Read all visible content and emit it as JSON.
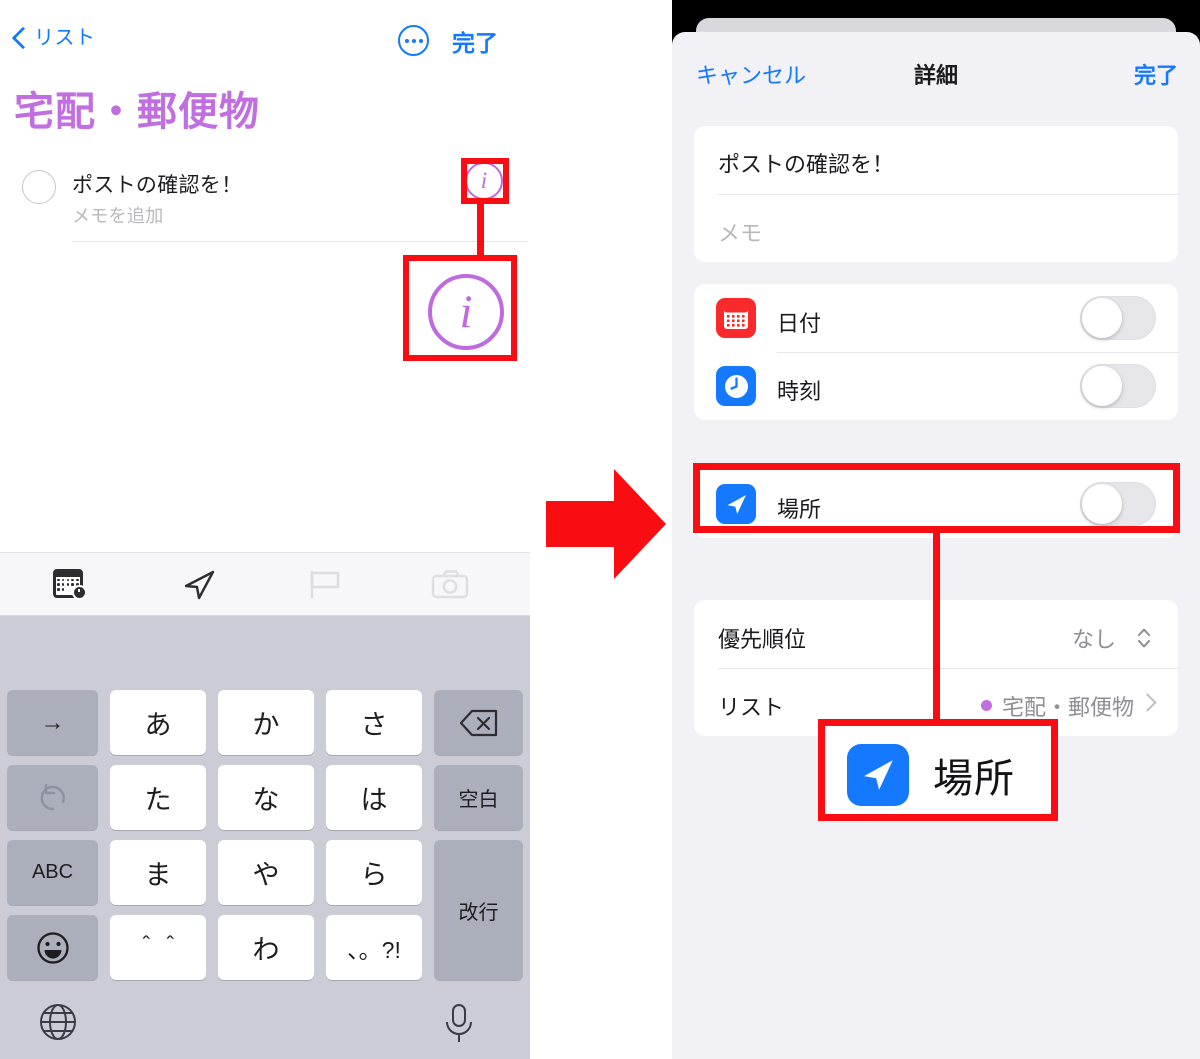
{
  "left": {
    "nav": {
      "back_label": "リスト",
      "more_icon": "ellipsis-circle-icon",
      "done_label": "完了"
    },
    "list_title": "宅配・郵便物",
    "task": {
      "title": "ポストの確認を！",
      "note_placeholder": "メモを追加",
      "info_glyph": "i"
    },
    "callout": {
      "info_glyph": "i"
    },
    "toolbar": [
      {
        "icon": "calendar-clock-icon",
        "active": true
      },
      {
        "icon": "location-arrow-icon",
        "active": true
      },
      {
        "icon": "flag-icon",
        "active": false
      },
      {
        "icon": "camera-icon",
        "active": false
      }
    ],
    "keyboard": {
      "rows": [
        [
          {
            "label": "→",
            "style": "gray",
            "name": "cursor-right-key"
          },
          {
            "label": "あ",
            "style": "white",
            "name": "kana-a-key"
          },
          {
            "label": "か",
            "style": "white",
            "name": "kana-ka-key"
          },
          {
            "label": "さ",
            "style": "white",
            "name": "kana-sa-key"
          },
          {
            "label": "",
            "style": "gray",
            "name": "backspace-key"
          }
        ],
        [
          {
            "label": "↺",
            "style": "gray",
            "name": "undo-key"
          },
          {
            "label": "た",
            "style": "white",
            "name": "kana-ta-key"
          },
          {
            "label": "な",
            "style": "white",
            "name": "kana-na-key"
          },
          {
            "label": "は",
            "style": "white",
            "name": "kana-ha-key"
          },
          {
            "label": "空白",
            "style": "gray",
            "name": "space-key"
          }
        ],
        [
          {
            "label": "ABC",
            "style": "gray",
            "name": "abc-key"
          },
          {
            "label": "ま",
            "style": "white",
            "name": "kana-ma-key"
          },
          {
            "label": "や",
            "style": "white",
            "name": "kana-ya-key"
          },
          {
            "label": "ら",
            "style": "white",
            "name": "kana-ra-key"
          },
          {
            "label": "改行",
            "style": "gray",
            "name": "return-key"
          }
        ],
        [
          {
            "label": "☺",
            "style": "gray",
            "name": "emoji-key"
          },
          {
            "label": "＾＾",
            "style": "white",
            "name": "kaomoji-key"
          },
          {
            "label": "わ",
            "style": "white",
            "name": "kana-wa-key"
          },
          {
            "label": "、。?!",
            "style": "white",
            "name": "punctuation-key"
          }
        ]
      ],
      "globe_icon": "globe-icon",
      "mic_icon": "microphone-icon"
    }
  },
  "arrow": {
    "icon": "right-arrow-icon",
    "color": "#fa0d12"
  },
  "right": {
    "nav": {
      "cancel_label": "キャンセル",
      "title": "詳細",
      "done_label": "完了"
    },
    "fields": {
      "title_value": "ポストの確認を！",
      "memo_placeholder": "メモ"
    },
    "toggles": [
      {
        "label": "日付",
        "icon": "calendar-icon",
        "icon_color": "#fa2a2a",
        "on": false
      },
      {
        "label": "時刻",
        "icon": "clock-icon",
        "icon_color": "#1479ff",
        "on": false
      }
    ],
    "location_row": {
      "label": "場所",
      "icon": "location-arrow-icon",
      "icon_color": "#1479ff",
      "on": false
    },
    "detail_rows": [
      {
        "label": "優先順位",
        "value": "なし",
        "accessory": "up-down-chevron-icon"
      },
      {
        "label": "リスト",
        "value": "宅配・郵便物",
        "accessory": "chevron-right-icon",
        "dot_color": "#c06ee0"
      }
    ],
    "callout": {
      "label": "場所",
      "icon": "location-arrow-icon",
      "icon_color": "#1479ff"
    }
  },
  "colors": {
    "accent_blue": "#1479ff",
    "purple": "#c06ee0",
    "highlight_red": "#fa0d12",
    "sheet_bg": "#f2f2f6",
    "keyboard_bg": "#ccccd6"
  }
}
